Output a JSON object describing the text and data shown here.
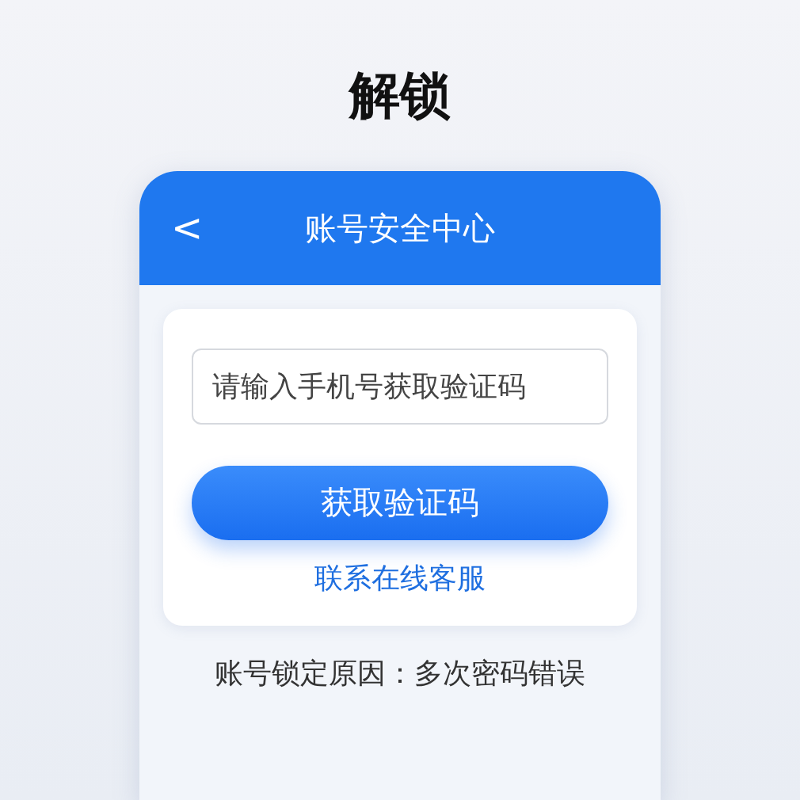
{
  "page_title": "解锁",
  "header": {
    "back": "<",
    "title": "账号安全中心"
  },
  "phone_field": {
    "placeholder": "请输入手机号获取验证码"
  },
  "get_code_button": "获取验证码",
  "support_link": "联系在线客服",
  "lock_reason": "账号锁定原因：多次密码错误"
}
